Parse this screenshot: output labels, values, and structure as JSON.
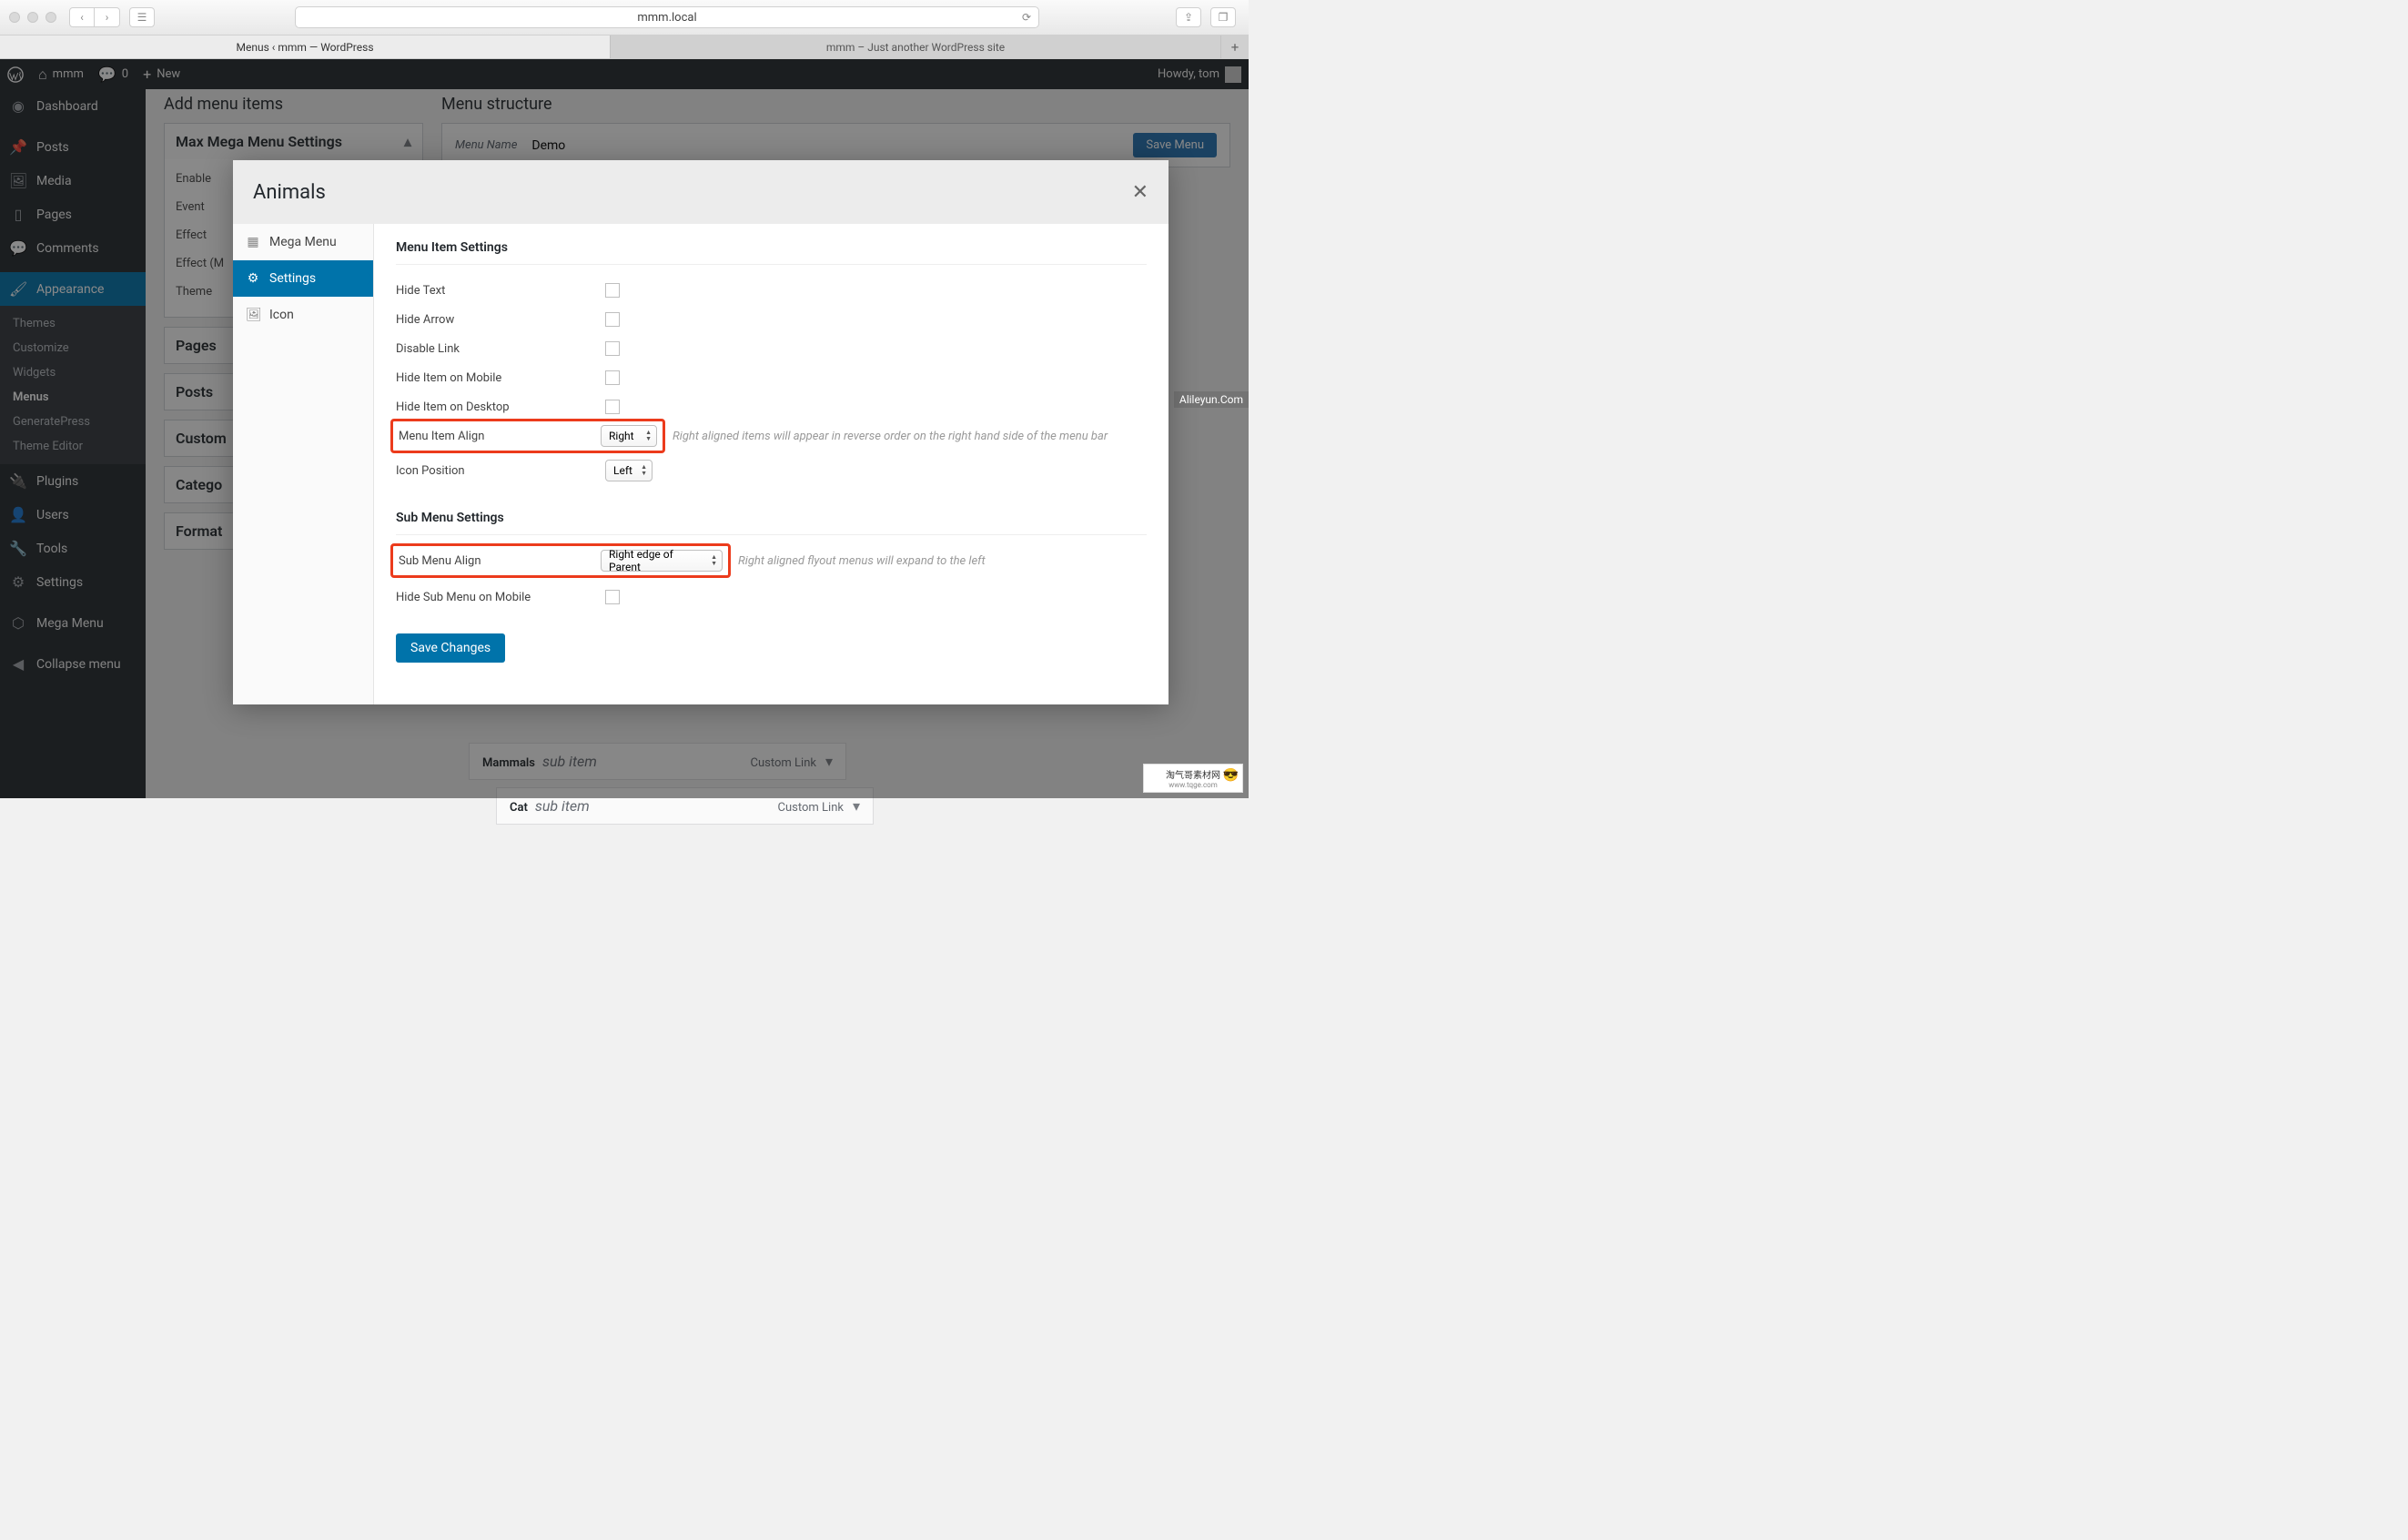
{
  "browser": {
    "url": "mmm.local",
    "tabs": [
      {
        "label": "Menus ‹ mmm — WordPress",
        "active": true
      },
      {
        "label": "mmm – Just another WordPress site",
        "active": false
      }
    ]
  },
  "adminbar": {
    "site": "mmm",
    "comments": "0",
    "new": "New",
    "howdy": "Howdy, tom"
  },
  "sidebar": {
    "items": [
      {
        "icon": "dashboard",
        "label": "Dashboard"
      },
      {
        "icon": "pin",
        "label": "Posts"
      },
      {
        "icon": "media",
        "label": "Media"
      },
      {
        "icon": "page",
        "label": "Pages"
      },
      {
        "icon": "comment",
        "label": "Comments"
      },
      {
        "icon": "brush",
        "label": "Appearance",
        "current": true
      },
      {
        "icon": "plugin",
        "label": "Plugins"
      },
      {
        "icon": "user",
        "label": "Users"
      },
      {
        "icon": "wrench",
        "label": "Tools"
      },
      {
        "icon": "sliders",
        "label": "Settings"
      },
      {
        "icon": "cube",
        "label": "Mega Menu"
      },
      {
        "icon": "collapse",
        "label": "Collapse menu"
      }
    ],
    "appearance_sub": [
      "Themes",
      "Customize",
      "Widgets",
      "Menus",
      "GeneratePress",
      "Theme Editor"
    ],
    "appearance_sub_current": "Menus"
  },
  "page": {
    "add_heading": "Add menu items",
    "struct_heading": "Menu structure",
    "panel_title": "Max Mega Menu Settings",
    "panel_rows": [
      "Enable",
      "Event",
      "Effect",
      "Effect (M",
      "Theme"
    ],
    "closed_panels": [
      "Pages",
      "Posts",
      "Custom",
      "Catego",
      "Format"
    ],
    "menuname_label": "Menu Name",
    "menuname_value": "Demo",
    "save_menu": "Save Menu",
    "struct_items": [
      {
        "title": "Mammals",
        "sub": "sub item",
        "type": "Custom Link",
        "depth": 1
      },
      {
        "title": "Cat",
        "sub": "sub item",
        "type": "Custom Link",
        "depth": 2
      }
    ]
  },
  "modal": {
    "title": "Animals",
    "close": "✕",
    "tabs": [
      {
        "icon": "grid",
        "label": "Mega Menu"
      },
      {
        "icon": "gear",
        "label": "Settings",
        "active": true
      },
      {
        "icon": "image",
        "label": "Icon"
      }
    ],
    "section1": "Menu Item Settings",
    "section2": "Sub Menu Settings",
    "rows1": [
      {
        "label": "Hide Text",
        "type": "checkbox"
      },
      {
        "label": "Hide Arrow",
        "type": "checkbox"
      },
      {
        "label": "Disable Link",
        "type": "checkbox"
      },
      {
        "label": "Hide Item on Mobile",
        "type": "checkbox"
      },
      {
        "label": "Hide Item on Desktop",
        "type": "checkbox"
      },
      {
        "label": "Menu Item Align",
        "type": "select",
        "value": "Right",
        "desc": "Right aligned items will appear in reverse order on the right hand side of the menu bar",
        "highlight": true
      },
      {
        "label": "Icon Position",
        "type": "select",
        "value": "Left"
      }
    ],
    "rows2": [
      {
        "label": "Sub Menu Align",
        "type": "select",
        "value": "Right edge of Parent",
        "desc": "Right aligned flyout menus will expand to the left",
        "highlight": true
      },
      {
        "label": "Hide Sub Menu on Mobile",
        "type": "checkbox"
      }
    ],
    "save": "Save Changes"
  },
  "watermark_right": "Alileyun.Com",
  "watermark_bottom_1": "淘气哥素材网",
  "watermark_bottom_2": "www.tqge.com"
}
